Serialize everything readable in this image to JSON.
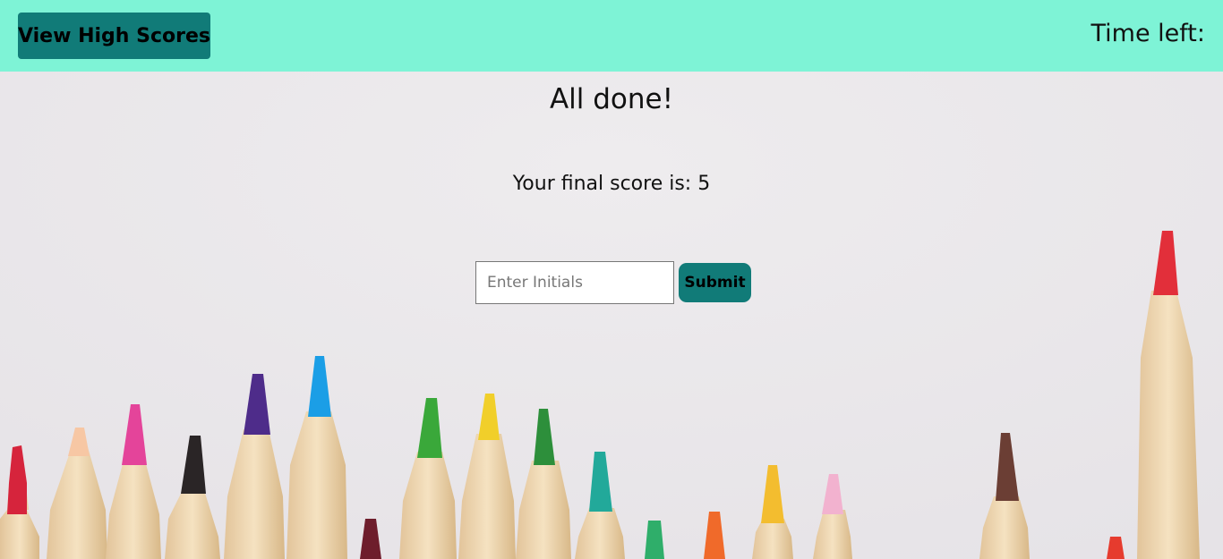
{
  "header": {
    "high_scores_label": "View High Scores",
    "time_label": "Time left:"
  },
  "main": {
    "title": "All done!",
    "score_text": "Your final score is: 5",
    "initials_placeholder": "Enter Initials",
    "initials_value": "",
    "submit_label": "Submit"
  },
  "colors": {
    "header_bg": "#7ef3d6",
    "button_bg": "#117b78",
    "page_bg": "#e9e7ea"
  },
  "background_image": "colored-pencils"
}
